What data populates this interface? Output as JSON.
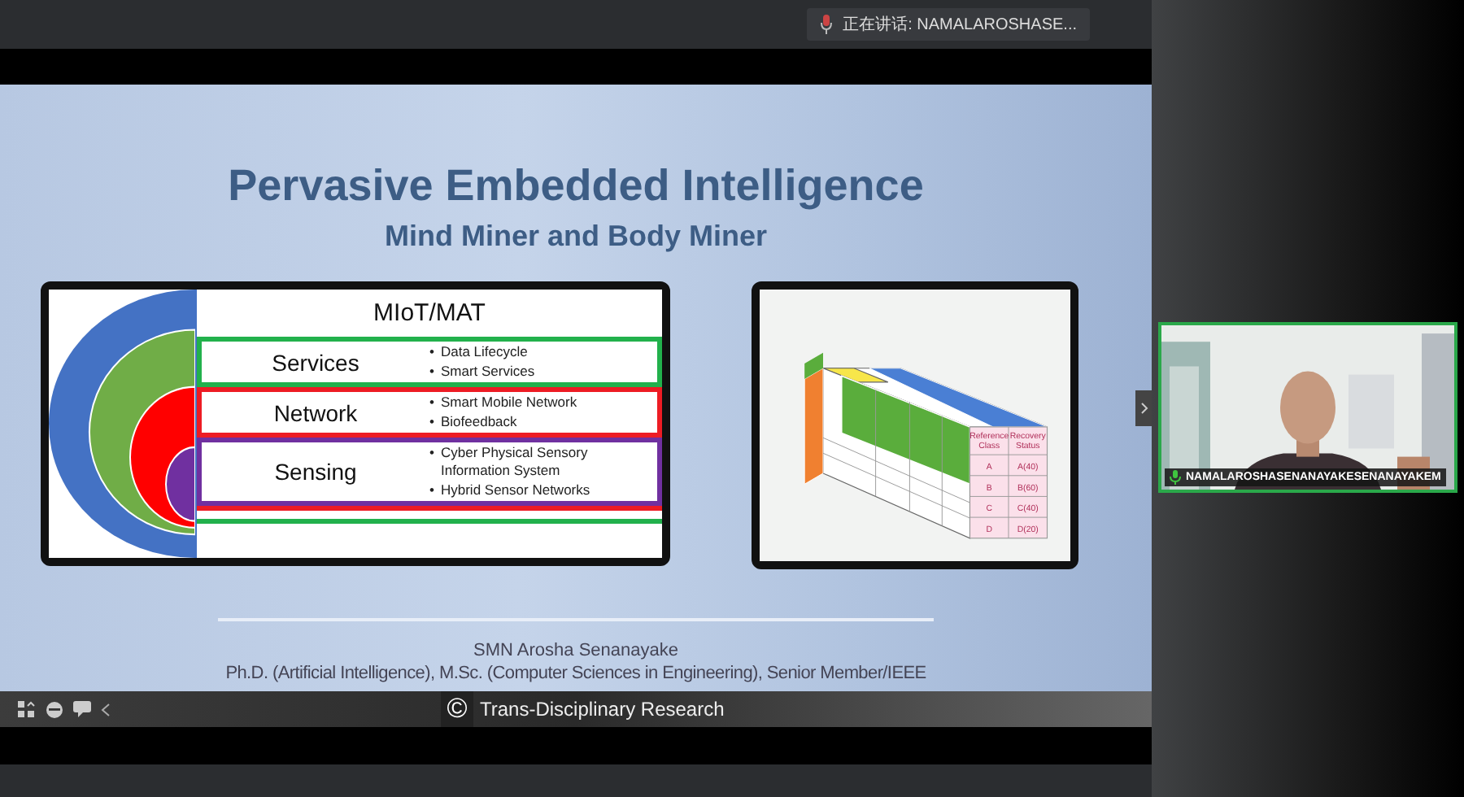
{
  "speaking_indicator": {
    "label": "正在讲话: NAMALAROSHASE..."
  },
  "slide": {
    "title": "Pervasive Embedded Intelligence",
    "subtitle": "Mind Miner and Body Miner",
    "diagram": {
      "header": "MIoT/MAT",
      "bullet_marker": "•",
      "layers": [
        {
          "name": "Services",
          "color": "#22b14c",
          "bullets": [
            "Data Lifecycle",
            "Smart Services"
          ]
        },
        {
          "name": "Network",
          "color": "#ed1c24",
          "bullets": [
            "Smart Mobile Network",
            "Biofeedback"
          ]
        },
        {
          "name": "Sensing",
          "color": "#7030a0",
          "bullets": [
            "Cyber Physical Sensory Information System",
            "Hybrid Sensor Networks"
          ]
        }
      ]
    },
    "cube": {
      "columns": [
        "Reference Class",
        "Recovery Status"
      ],
      "rows": [
        [
          "A",
          "A(40)"
        ],
        [
          "B",
          "B(60)"
        ],
        [
          "C",
          "C(40)"
        ],
        [
          "D",
          "D(20)"
        ]
      ]
    },
    "author": "SMN Arosha Senanayake",
    "credentials": "Ph.D. (Artificial Intelligence), M.Sc. (Computer Sciences in Engineering), Senior Member/IEEE",
    "footer": {
      "symbol": "©",
      "text": "Trans-Disciplinary Research"
    }
  },
  "participant": {
    "name": "NAMALAROSHASENANAYAKESENANAYAKEM",
    "kind": "picture"
  }
}
